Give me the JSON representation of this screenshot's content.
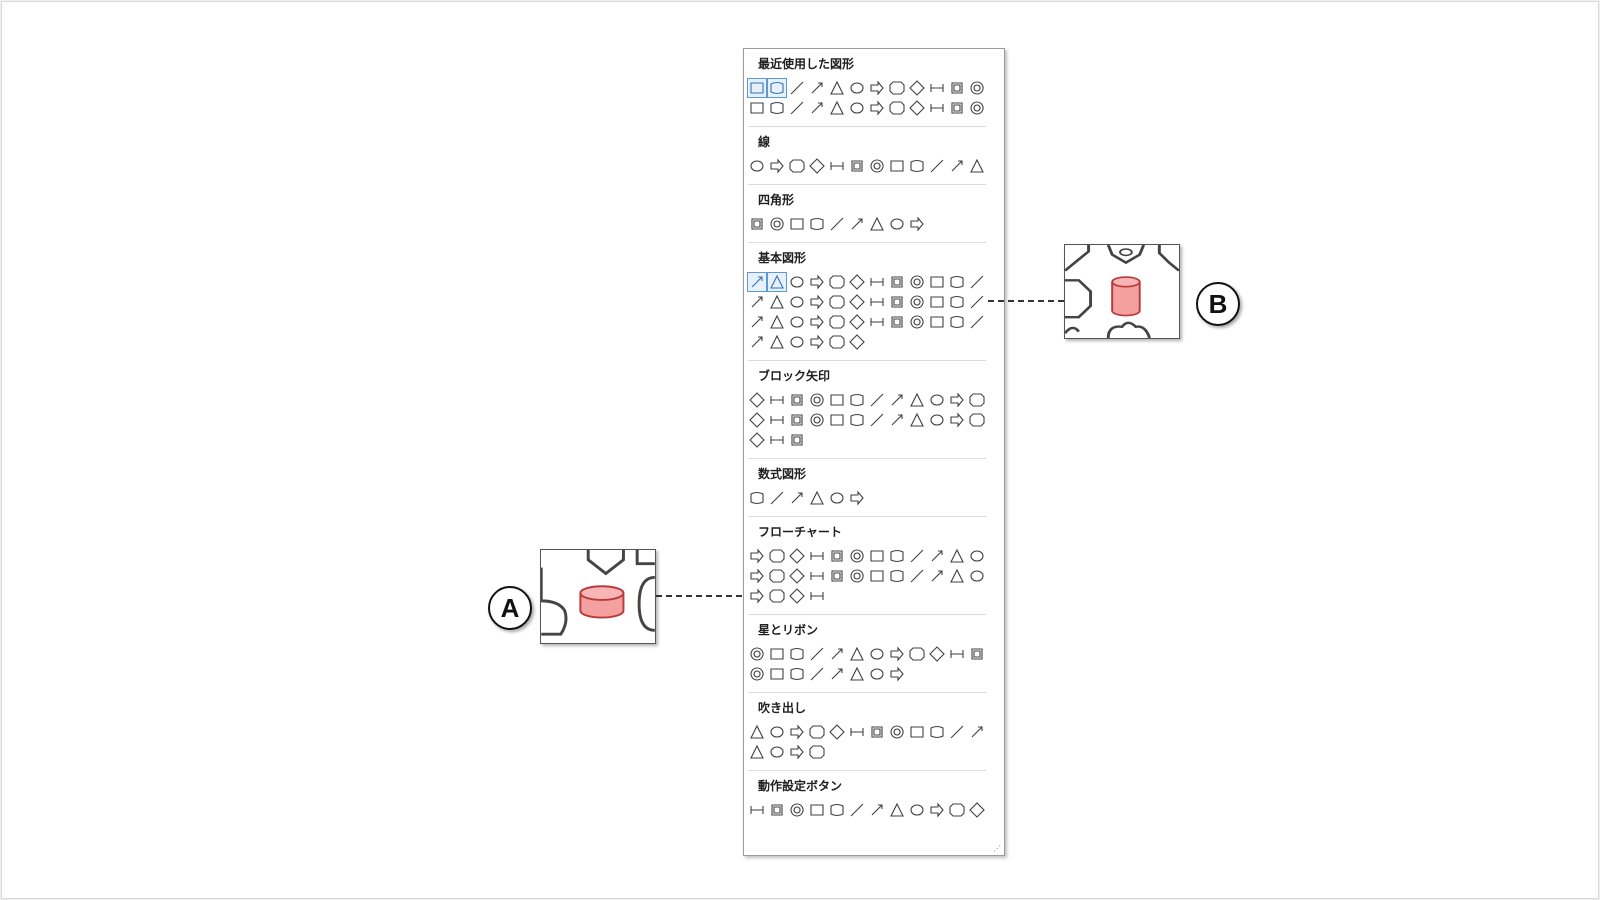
{
  "gallery": {
    "sections": [
      {
        "title": "最近使用した図形",
        "rows": 2,
        "shape_count": 24
      },
      {
        "title": "線",
        "rows": 1,
        "shape_count": 12
      },
      {
        "title": "四角形",
        "rows": 1,
        "shape_count": 9
      },
      {
        "title": "基本図形",
        "rows": 4,
        "shape_count": 42
      },
      {
        "title": "ブロック矢印",
        "rows": 3,
        "shape_count": 27
      },
      {
        "title": "数式図形",
        "rows": 1,
        "shape_count": 6
      },
      {
        "title": "フローチャート",
        "rows": 3,
        "shape_count": 28
      },
      {
        "title": "星とリボン",
        "rows": 2,
        "shape_count": 20
      },
      {
        "title": "吹き出し",
        "rows": 2,
        "shape_count": 16
      },
      {
        "title": "動作設定ボタン",
        "rows": 1,
        "shape_count": 12
      }
    ]
  },
  "callouts": {
    "a": {
      "label": "A",
      "highlight": "flowchart-magnetic-disk",
      "color": "#f4a0a0"
    },
    "b": {
      "label": "B",
      "highlight": "basic-shapes-can",
      "color": "#f4a0a0"
    }
  }
}
